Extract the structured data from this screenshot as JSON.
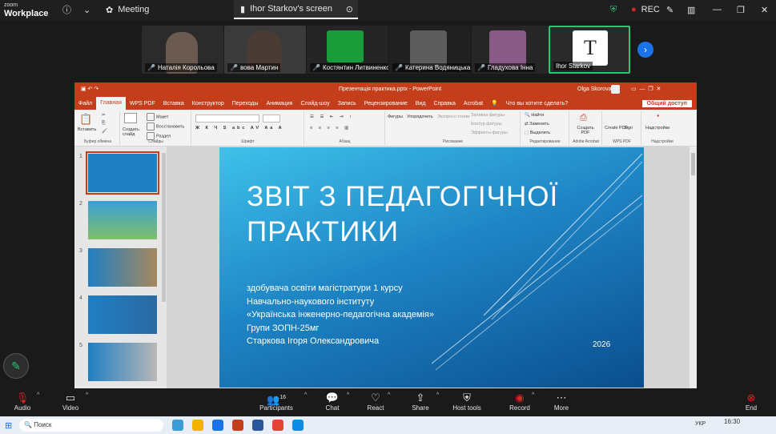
{
  "app": {
    "logo_line1": "zoom",
    "logo_line2": "Workplace"
  },
  "topbar": {
    "meeting_label": "Meeting",
    "share_tab": "Ihor Starkov's screen",
    "rec_label": "REC"
  },
  "participants": [
    {
      "name": "Наталія Корольова",
      "muted": true
    },
    {
      "name": "вова Мартин",
      "muted": true
    },
    {
      "name": "Костянтин Литвиненко",
      "muted": true
    },
    {
      "name": "Катерина Водяницька",
      "muted": true
    },
    {
      "name": "Гладухова Інна",
      "muted": true
    },
    {
      "name": "Ihor Starkov",
      "muted": false
    }
  ],
  "ppt": {
    "window_title": "Презентація практика.pptx - PowerPoint",
    "user": "Olga Skorova",
    "menu": [
      "Файл",
      "Главная",
      "WPS PDF",
      "Вставка",
      "Конструктор",
      "Переходы",
      "Анимация",
      "Слайд-шоу",
      "Запись",
      "Рецензирование",
      "Вид",
      "Справка",
      "Acrobat"
    ],
    "menu_active_index": 1,
    "tell_me": "Что вы хотите сделать?",
    "share_btn": "Общий доступ",
    "ribbon": {
      "paste": "Вставить",
      "clipboard_label": "Буфер обмена",
      "new_slide": "Создать слайд",
      "layout": "Макет",
      "reset": "Восстановить",
      "section": "Раздел",
      "slides_label": "Слайды",
      "font_label": "Шрифт",
      "para_label": "Абзац",
      "shapes": "Фигуры",
      "arrange": "Упорядочить",
      "quick_styles": "Экспресс-стили",
      "fill": "Заливка фигуры",
      "outline": "Контур фигуры",
      "effects": "Эффекты фигуры",
      "drawing_label": "Рисование",
      "find": "Найти",
      "replace": "Заменить",
      "select": "Выделить",
      "editing_label": "Редактирование",
      "create_pdf": "Создать PDF",
      "acrobat_label": "Adobe Acrobat",
      "create_sign": "Create PDF",
      "sign": "Sign",
      "wps_label": "WPS PDF",
      "addins": "Надстройки",
      "addins_label": "Надстройки"
    },
    "slide_numbers": [
      "1",
      "2",
      "3",
      "4",
      "5"
    ],
    "slide": {
      "title_line1": "ЗВІТ З ПЕДАГОГІЧНОЇ",
      "title_line2": "ПРАКТИКИ",
      "sub": [
        "здобувача освіти магістратури 1 курсу",
        "Навчально-наукового інституту",
        "«Українська інженерно-педагогічна академія»",
        "Групи ЗОПН-25мг",
        "Старкова Ігоря Олександровича"
      ],
      "year": "2026"
    }
  },
  "controls": [
    {
      "label": "Audio",
      "icon": "mic-muted-icon"
    },
    {
      "label": "Video",
      "icon": "camera-icon"
    },
    {
      "label": "Participants",
      "icon": "people-icon",
      "count": "16"
    },
    {
      "label": "Chat",
      "icon": "chat-icon"
    },
    {
      "label": "React",
      "icon": "heart-icon"
    },
    {
      "label": "Share",
      "icon": "share-icon"
    },
    {
      "label": "Host tools",
      "icon": "shield-icon"
    },
    {
      "label": "Record",
      "icon": "record-icon"
    },
    {
      "label": "More",
      "icon": "more-icon"
    },
    {
      "label": "End",
      "icon": "end-icon"
    }
  ],
  "taskbar": {
    "search": "Поиск",
    "lang": "УКР",
    "time": "16:30"
  },
  "colors": {
    "ppt_accent": "#c43e1c",
    "speaking": "#29c76f",
    "record": "#e02424"
  }
}
